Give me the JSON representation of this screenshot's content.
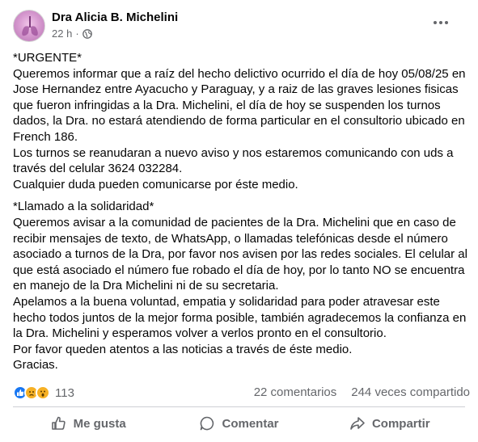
{
  "post": {
    "author": "Dra Alicia B. Michelini",
    "time": "22 h",
    "separator": "·",
    "paragraphs": [
      "*URGENTE*\nQueremos informar que a raíz del hecho delictivo ocurrido el día de hoy 05/08/25 en Jose Hernandez entre Ayacucho y Paraguay, y a raiz de las graves lesiones fisicas que fueron infringidas a la Dra. Michelini, el día de hoy se suspenden los turnos dados, la Dra. no estará atendiendo de forma particular en el consultorio ubicado en French 186.\nLos turnos se reanudaran a nuevo aviso y nos estaremos comunicando con uds a través del celular 3624 032284.\nCualquier duda pueden comunicarse por éste medio.",
      "*Llamado a la solidaridad*\nQueremos avisar a la comunidad de pacientes de la Dra. Michelini que en caso de recibir mensajes de texto, de WhatsApp, o llamadas telefónicas desde el número asociado a turnos de la Dra, por favor nos avisen por las redes sociales. El celular al que está asociado el número fue robado el día de hoy, por lo tanto NO se encuentra en manejo de la Dra Michelini ni de su secretaria.\nApelamos a la buena voluntad, empatia y solidaridad para poder atravesar este hecho todos juntos de la mejor forma posible, también agradecemos la confianza en la Dra. Michelini y esperamos volver a verlos pronto en el consultorio.\nPor favor queden atentos a las noticias a través de éste medio.\nGracias."
    ]
  },
  "reactions": {
    "icons": [
      "like-icon",
      "sad-icon",
      "wow-icon"
    ],
    "count": "113",
    "comments": "22 comentarios",
    "shares": "244 veces compartido"
  },
  "actions": {
    "like": "Me gusta",
    "comment": "Comentar",
    "share": "Compartir"
  },
  "colors": {
    "text": "#050505",
    "secondary": "#65676b",
    "like_blue": "#1877f2",
    "emoji_yellow": "#f7b125"
  }
}
